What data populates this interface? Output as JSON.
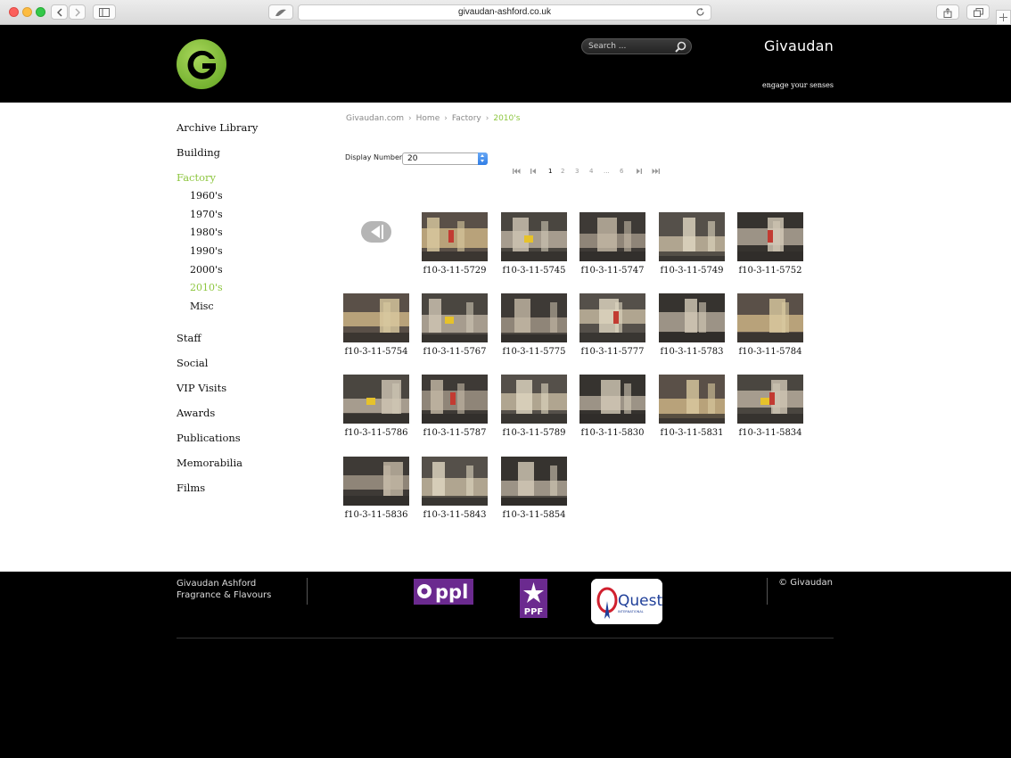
{
  "browser": {
    "url": "givaudan-ashford.co.uk"
  },
  "header": {
    "brand": "Givaudan",
    "tagline": "engage your senses",
    "search_placeholder": "Search ..."
  },
  "sidebar": {
    "items": [
      {
        "label": "Archive Library"
      },
      {
        "label": "Building"
      },
      {
        "label": "Factory",
        "active": true
      },
      {
        "label": "1960's",
        "sub": true
      },
      {
        "label": "1970's",
        "sub": true
      },
      {
        "label": "1980's",
        "sub": true
      },
      {
        "label": "1990's",
        "sub": true
      },
      {
        "label": "2000's",
        "sub": true
      },
      {
        "label": "2010's",
        "sub": true,
        "active": true
      },
      {
        "label": "Misc",
        "sub": true
      },
      {
        "label": "Staff"
      },
      {
        "label": "Social"
      },
      {
        "label": "VIP Visits"
      },
      {
        "label": "Awards"
      },
      {
        "label": "Publications"
      },
      {
        "label": "Memorabilia"
      },
      {
        "label": "Films"
      }
    ]
  },
  "breadcrumb": [
    "Givaudan.com",
    "Home",
    "Factory",
    "2010's"
  ],
  "display": {
    "label": "Display Number",
    "value": "20"
  },
  "pagination": {
    "pages": [
      "1",
      "2",
      "3",
      "4",
      "...",
      "6"
    ],
    "current": "1"
  },
  "gallery": {
    "items": [
      "f10-3-11-5729",
      "f10-3-11-5745",
      "f10-3-11-5747",
      "f10-3-11-5749",
      "f10-3-11-5752",
      "f10-3-11-5754",
      "f10-3-11-5767",
      "f10-3-11-5775",
      "f10-3-11-5777",
      "f10-3-11-5783",
      "f10-3-11-5784",
      "f10-3-11-5786",
      "f10-3-11-5787",
      "f10-3-11-5789",
      "f10-3-11-5830",
      "f10-3-11-5831",
      "f10-3-11-5834",
      "f10-3-11-5836",
      "f10-3-11-5843",
      "f10-3-11-5854"
    ]
  },
  "footer": {
    "company_line1": "Givaudan Ashford",
    "company_line2": "Fragrance & Flavours",
    "copyright": "© Givaudan",
    "logos": [
      "ppl",
      "PPF",
      "Quest",
      "INTERNATIONAL"
    ]
  },
  "colors": {
    "accent": "#8dc63f",
    "logo_purple": "#6b2a8f",
    "quest_red": "#d0202e",
    "quest_blue": "#1f3f99"
  }
}
